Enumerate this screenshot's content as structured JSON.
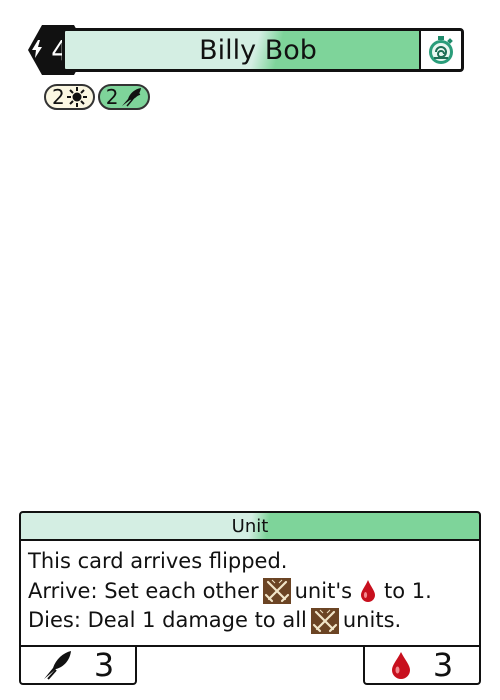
{
  "card": {
    "cost": "4",
    "name": "Billy Bob",
    "type_line": "Unit",
    "resources": [
      {
        "value": "2",
        "icon": "sun-icon"
      },
      {
        "value": "2",
        "icon": "quill-icon"
      }
    ],
    "rules": {
      "line1": "This card arrives flipped.",
      "line2_a": "Arrive: Set each other",
      "line2_b": "unit's",
      "line2_c": "to 1.",
      "line3_a": "Dies: Deal 1 damage to all",
      "line3_b": "units."
    },
    "power": "3",
    "health": "3"
  },
  "colors": {
    "accent_green": "#7ed49a",
    "pale_green": "#d4eee3",
    "blood_red": "#c8101e",
    "crossed_swords_brown": "#6b4424"
  }
}
